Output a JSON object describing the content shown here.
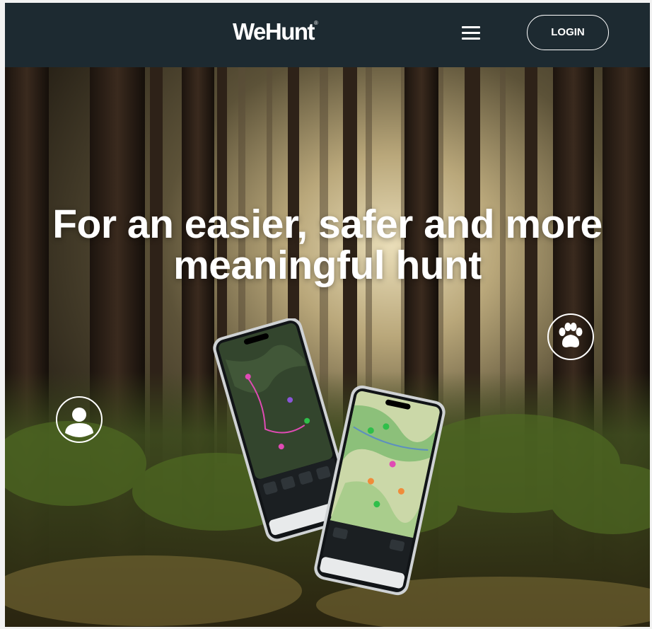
{
  "brand": {
    "name": "WeHunt",
    "mark": "®"
  },
  "nav": {
    "login_label": "LOGIN",
    "menu_icon": "hamburger-menu-icon"
  },
  "hero": {
    "headline_line1": "For an easier, safer and more",
    "headline_line2": "meaningful hunt",
    "icons": [
      "person-icon",
      "paw-icon"
    ]
  },
  "colors": {
    "navbar": "#1d2a31",
    "accent_pink": "#e04bb4",
    "accent_green": "#2fbf4a",
    "white": "#ffffff"
  }
}
